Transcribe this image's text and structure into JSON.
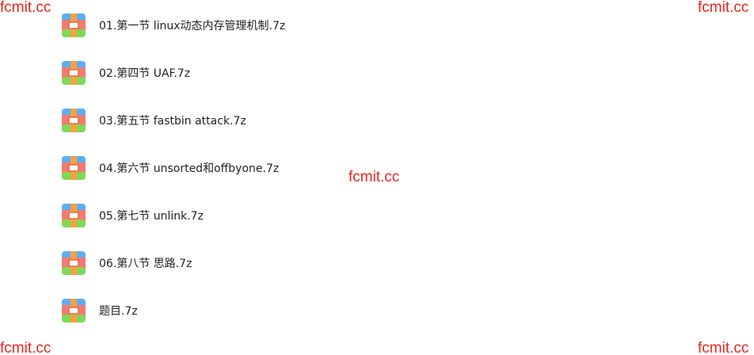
{
  "watermark": {
    "text": "fcmit.cc",
    "color": "#e8251e"
  },
  "files": [
    {
      "name": "01.第一节 linux动态内存管理机制.7z",
      "icon": "archive-icon"
    },
    {
      "name": "02.第四节 UAF.7z",
      "icon": "archive-icon"
    },
    {
      "name": "03.第五节 fastbin attack.7z",
      "icon": "archive-icon"
    },
    {
      "name": "04.第六节 unsorted和offbyone.7z",
      "icon": "archive-icon"
    },
    {
      "name": "05.第七节 unlink.7z",
      "icon": "archive-icon"
    },
    {
      "name": "06.第八节 思路.7z",
      "icon": "archive-icon"
    },
    {
      "name": "题目.7z",
      "icon": "archive-icon"
    }
  ],
  "icon_colors": {
    "top": "#5aaef5",
    "middle": "#f57a72",
    "bottom": "#7ed957",
    "strap": "#f5a142",
    "buckle": "#ffffff"
  }
}
